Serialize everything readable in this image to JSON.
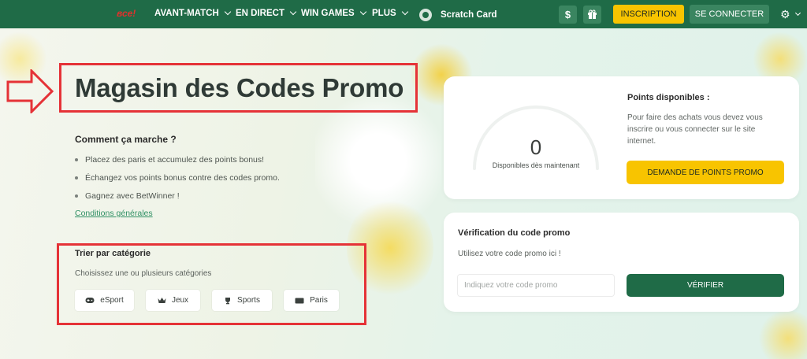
{
  "nav": {
    "logo": "все!",
    "items": [
      {
        "label": "AVANT-MATCH"
      },
      {
        "label": "EN DIRECT"
      },
      {
        "label": "WIN GAMES"
      },
      {
        "label": "PLUS"
      }
    ],
    "scratch_card": "Scratch Card",
    "dollar_icon": "$",
    "inscription": "INSCRIPTION",
    "connect": "SE CONNECTER",
    "colors": {
      "nav_bg": "#1f6b47",
      "accent_yellow": "#f8c400",
      "highlight_red": "#e53237"
    }
  },
  "main": {
    "title": "Magasin des Codes Promo",
    "how_title": "Comment ça marche ?",
    "bullets": [
      "Placez des paris et accumulez des points bonus!",
      "Échangez vos points bonus contre des codes promo.",
      "Gagnez avec BetWinner !"
    ],
    "terms_link": "Conditions générales",
    "category": {
      "title": "Trier par catégorie",
      "subtitle": "Choisissez une ou plusieurs catégories",
      "chips": [
        {
          "label": "eSport",
          "icon": "gamepad-icon"
        },
        {
          "label": "Jeux",
          "icon": "crown-icon"
        },
        {
          "label": "Sports",
          "icon": "trophy-icon"
        },
        {
          "label": "Paris",
          "icon": "ticket-icon"
        }
      ]
    }
  },
  "points": {
    "value": "0",
    "gauge_label": "Disponibles dès maintenant",
    "title": "Points disponibles :",
    "text": "Pour faire des achats vous devez vous inscrire ou vous connecter sur le site internet.",
    "button": "DEMANDE DE POINTS PROMO"
  },
  "verify": {
    "title": "Vérification du code promo",
    "subtitle": "Utilisez votre code promo ici !",
    "input_value": "",
    "input_placeholder": "Indiquez votre code promo",
    "button": "VÉRIFIER"
  }
}
